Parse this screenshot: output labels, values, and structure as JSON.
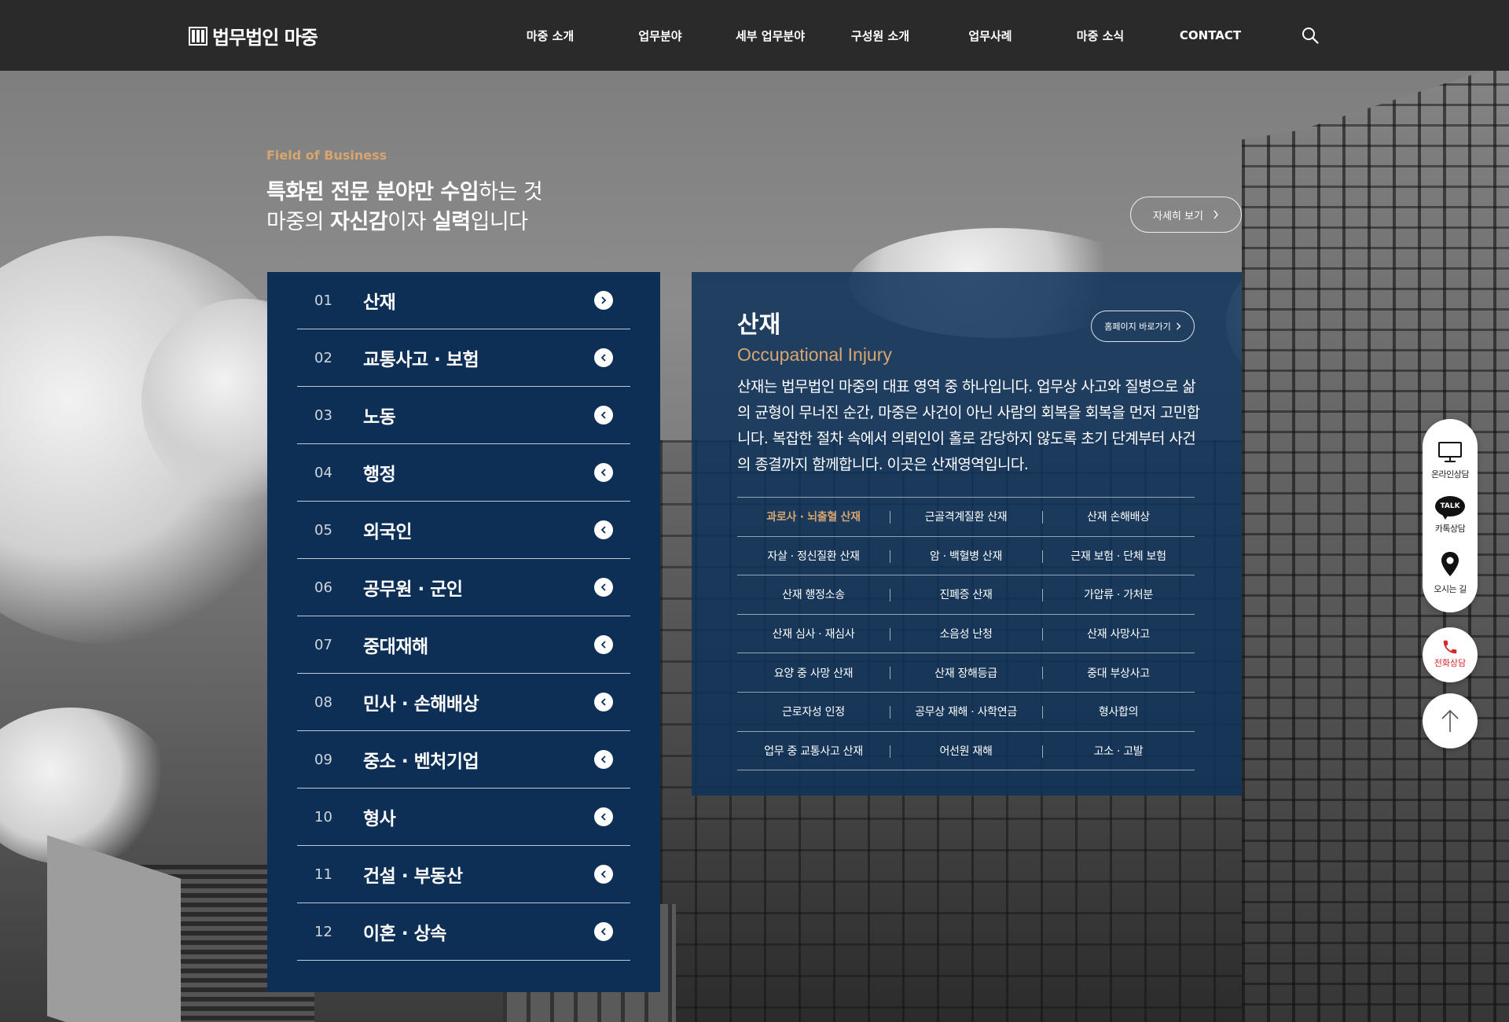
{
  "header": {
    "logo_text": "법무법인 마중",
    "nav": [
      "마중 소개",
      "업무분야",
      "세부 업무분야",
      "구성원 소개",
      "업무사례",
      "마중 소식",
      "CONTACT"
    ]
  },
  "section": {
    "eyebrow": "Field of Business",
    "headline_line1_bold": "특화된 전문 분야만 수임",
    "headline_line1_rest": "하는 것",
    "headline_line2_a": "마중의 ",
    "headline_line2_b": "자신감",
    "headline_line2_c": "이자 ",
    "headline_line2_d": "실력",
    "headline_line2_e": "입니다",
    "more_label": "자세히 보기"
  },
  "fields": [
    {
      "num": "01",
      "label": "산재"
    },
    {
      "num": "02",
      "label": "교통사고 · 보험"
    },
    {
      "num": "03",
      "label": "노동"
    },
    {
      "num": "04",
      "label": "행정"
    },
    {
      "num": "05",
      "label": "외국인"
    },
    {
      "num": "06",
      "label": "공무원 · 군인"
    },
    {
      "num": "07",
      "label": "중대재해"
    },
    {
      "num": "08",
      "label": "민사 · 손해배상"
    },
    {
      "num": "09",
      "label": "중소 · 벤처기업"
    },
    {
      "num": "10",
      "label": "형사"
    },
    {
      "num": "11",
      "label": "건설 · 부동산"
    },
    {
      "num": "12",
      "label": "이혼 · 상속"
    }
  ],
  "detail": {
    "title": "산재",
    "subtitle": "Occupational Injury",
    "homepage_label": "홈페이지 바로가기",
    "description": "산재는 법무법인 마중의 대표 영역 중 하나입니다. 업무상 사고와 질병으로 삶의 균형이 무너진 순간, 마중은 사건이 아닌 사람의 회복을 회복을 먼저 고민합니다. 복잡한 절차 속에서 의뢰인이 홀로 감당하지 않도록 초기 단계부터 사건의 종결까지 함께합니다. 이곳은 산재영역입니다.",
    "grid": [
      [
        "과로사 · 뇌출혈 산재",
        "근골격계질환 산재",
        "산재 손해배상"
      ],
      [
        "자살 · 정신질환 산재",
        "암 · 백혈병 산재",
        "근재 보험 · 단체 보험"
      ],
      [
        "산재 행정소송",
        "진폐증 산재",
        "가압류 · 가처분"
      ],
      [
        "산재 심사 · 재심사",
        "소음성 난청",
        "산재 사망사고"
      ],
      [
        "요양 중 사망 산재",
        "산재 장해등급",
        "중대 부상사고"
      ],
      [
        "근로자성 인정",
        "공무상 재해 · 사학연금",
        "형사합의"
      ],
      [
        "업무 중 교통사고 산재",
        "어선원 재해",
        "고소 · 고발"
      ]
    ]
  },
  "quick_menu": {
    "online": "온라인상담",
    "talk_badge": "TALK",
    "kakao": "카톡상담",
    "location": "오시는 길",
    "phone": "전화상담"
  },
  "colors": {
    "accent": "#d8a56f",
    "panel": "#0e2f55",
    "header": "#2a2a2b",
    "phone": "#d6262a"
  }
}
